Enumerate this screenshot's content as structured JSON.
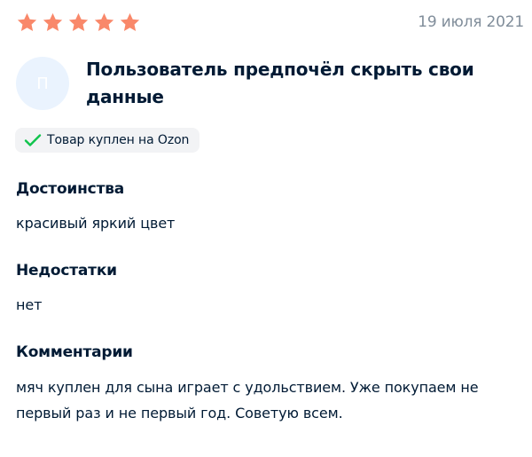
{
  "review": {
    "rating": 5,
    "rating_max": 5,
    "star_color": "#f9886a",
    "date": "19 июля 2021",
    "avatar_initial": "П",
    "author": "Пользователь предпочёл скрыть свои данные",
    "badge": {
      "icon": "checkmark-icon",
      "icon_color": "#10c44c",
      "label": "Товар куплен на Ozon"
    },
    "sections": [
      {
        "title": "Достоинства",
        "text": "красивый яркий цвет"
      },
      {
        "title": "Недостатки",
        "text": "нет"
      },
      {
        "title": "Комментарии",
        "text": "мяч куплен для сына играет с удольствием. Уже покупаем не первый раз и не первый год. Советую всем."
      }
    ]
  }
}
